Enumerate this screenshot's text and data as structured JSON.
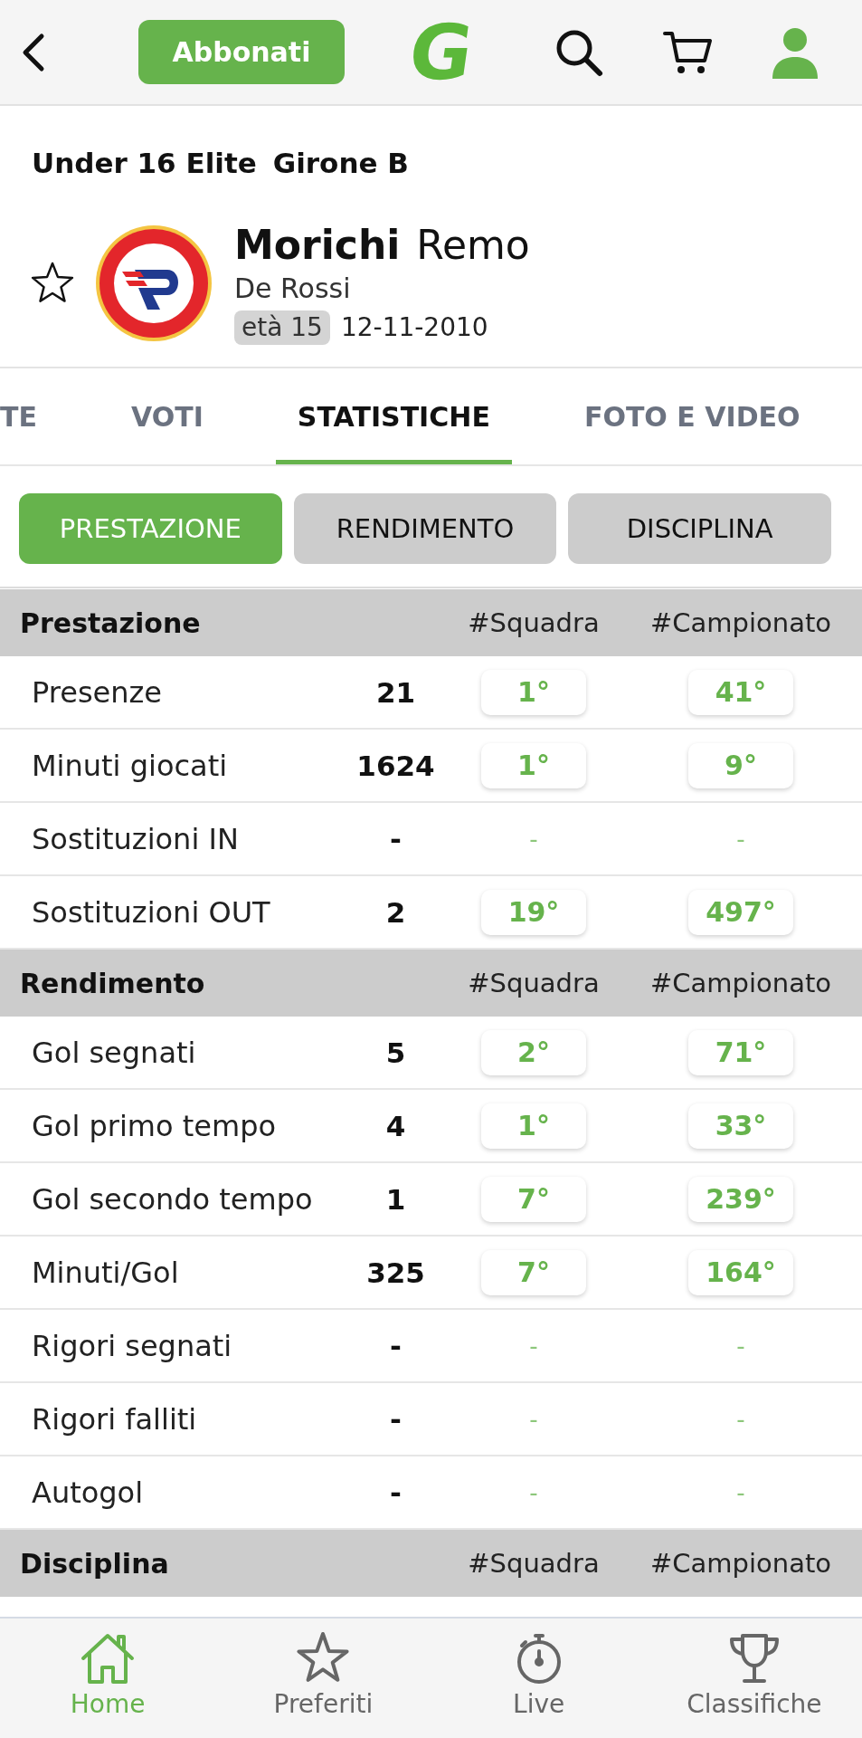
{
  "top_bar": {
    "subscribe_button": "Abbonati",
    "logo": "G"
  },
  "competition": {
    "category": "Under 16 Elite",
    "group": "Girone B"
  },
  "player": {
    "favorite": false,
    "surname": "Morichi",
    "name": "Remo",
    "team": "De Rossi",
    "age": "età 15",
    "birth_date": "12-11-2010"
  },
  "tabs": [
    {
      "label": "TE",
      "selected": false
    },
    {
      "label": "VOTI",
      "selected": false
    },
    {
      "label": "STATISTICHE",
      "selected": true
    },
    {
      "label": "FOTO E VIDEO",
      "selected": false
    }
  ],
  "sub_tabs": [
    {
      "label": "PRESTAZIONE",
      "selected": true
    },
    {
      "label": "RENDIMENTO",
      "selected": false
    },
    {
      "label": "DISCIPLINA",
      "selected": false
    }
  ],
  "sections": [
    {
      "title": "Prestazione",
      "columns": [
        "#Squadra",
        "#Campionato"
      ],
      "rows": [
        {
          "label": "Presenze",
          "value": "21",
          "ranked": true,
          "team_rank": "1°",
          "league_rank": "41°"
        },
        {
          "label": "Minuti giocati",
          "value": "1624",
          "ranked": true,
          "team_rank": "1°",
          "league_rank": "9°"
        },
        {
          "label": "Sostituzioni IN",
          "value": "-",
          "ranked": false,
          "team_rank": "-",
          "league_rank": "-"
        },
        {
          "label": "Sostituzioni OUT",
          "value": "2",
          "ranked": true,
          "team_rank": "19°",
          "league_rank": "497°"
        }
      ]
    },
    {
      "title": "Rendimento",
      "columns": [
        "#Squadra",
        "#Campionato"
      ],
      "rows": [
        {
          "label": "Gol segnati",
          "value": "5",
          "ranked": true,
          "team_rank": "2°",
          "league_rank": "71°"
        },
        {
          "label": "Gol primo tempo",
          "value": "4",
          "ranked": true,
          "team_rank": "1°",
          "league_rank": "33°"
        },
        {
          "label": "Gol secondo tempo",
          "value": "1",
          "ranked": true,
          "team_rank": "7°",
          "league_rank": "239°"
        },
        {
          "label": "Minuti/Gol",
          "value": "325",
          "ranked": true,
          "team_rank": "7°",
          "league_rank": "164°"
        },
        {
          "label": "Rigori segnati",
          "value": "-",
          "ranked": false,
          "team_rank": "-",
          "league_rank": "-"
        },
        {
          "label": "Rigori falliti",
          "value": "-",
          "ranked": false,
          "team_rank": "-",
          "league_rank": "-"
        },
        {
          "label": "Autogol",
          "value": "-",
          "ranked": false,
          "team_rank": "-",
          "league_rank": "-"
        }
      ]
    },
    {
      "title": "Disciplina",
      "columns": [
        "#Squadra",
        "#Campionato"
      ]
    }
  ],
  "bottom_nav": [
    {
      "label": "Home",
      "kind": "home",
      "selected": true
    },
    {
      "label": "Preferiti",
      "kind": "favorites",
      "selected": false
    },
    {
      "label": "Live",
      "kind": "live",
      "selected": false
    },
    {
      "label": "Classifiche",
      "kind": "standings",
      "selected": false
    }
  ]
}
